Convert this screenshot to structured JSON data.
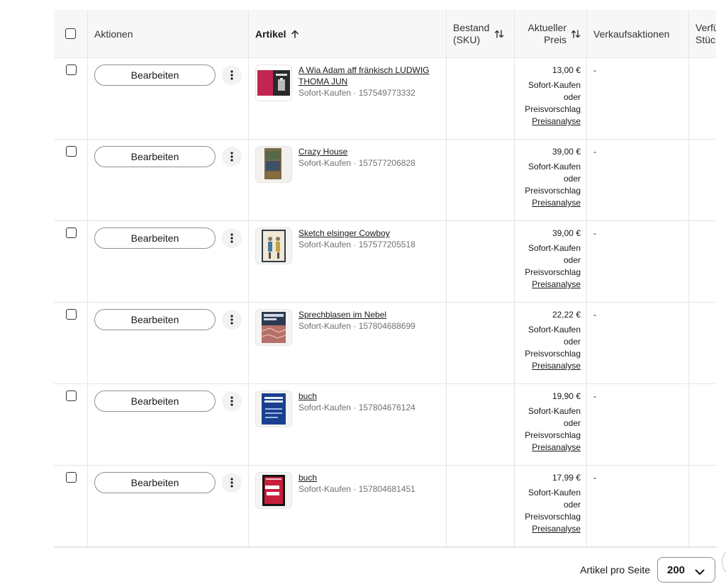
{
  "table": {
    "header": {
      "select_all": "",
      "actions": "Aktionen",
      "item": "Artikel",
      "stock_line1": "Bestand",
      "stock_line2": "(SKU)",
      "price_line1": "Aktueller",
      "price_line2": "Preis",
      "promotions": "Verkaufsaktionen",
      "available_line1": "Verfügbar",
      "available_line2": "Stück"
    },
    "rows": [
      {
        "edit_label": "Bearbeiten",
        "title": "A Wia Adam aff fränkisch LUDWIG THOMA JUN",
        "meta": "Sofort-Kaufen · 157549773332",
        "price": "13,00 €",
        "format": "Sofort-Kaufen oder Preisvorschlag",
        "analysis_link": "Preisanalyse",
        "promo": "-",
        "thumb_icon": "book-cover-red-thumbnail"
      },
      {
        "edit_label": "Bearbeiten",
        "title": "Crazy House",
        "meta": "Sofort-Kaufen · 157577206828",
        "price": "39,00 €",
        "format": "Sofort-Kaufen oder Preisvorschlag",
        "analysis_link": "Preisanalyse",
        "promo": "-",
        "thumb_icon": "painting-thumbnail"
      },
      {
        "edit_label": "Bearbeiten",
        "title": "Sketch elsinger Cowboy",
        "meta": "Sofort-Kaufen · 157577205518",
        "price": "39,00 €",
        "format": "Sofort-Kaufen oder Preisvorschlag",
        "analysis_link": "Preisanalyse",
        "promo": "-",
        "thumb_icon": "sketch-thumbnail"
      },
      {
        "edit_label": "Bearbeiten",
        "title": "Sprechblasen im Nebel",
        "meta": "Sofort-Kaufen · 157804688699",
        "price": "22,22 €",
        "format": "Sofort-Kaufen oder Preisvorschlag",
        "analysis_link": "Preisanalyse",
        "promo": "-",
        "thumb_icon": "book-cover-dark-thumbnail"
      },
      {
        "edit_label": "Bearbeiten",
        "title": "buch",
        "meta": "Sofort-Kaufen · 157804676124",
        "price": "19,90 €",
        "format": "Sofort-Kaufen oder Preisvorschlag",
        "analysis_link": "Preisanalyse",
        "promo": "-",
        "thumb_icon": "book-cover-blue-thumbnail"
      },
      {
        "edit_label": "Bearbeiten",
        "title": "buch",
        "meta": "Sofort-Kaufen · 157804681451",
        "price": "17,99 €",
        "format": "Sofort-Kaufen oder Preisvorschlag",
        "analysis_link": "Preisanalyse",
        "promo": "-",
        "thumb_icon": "book-cover-black-thumbnail"
      }
    ]
  },
  "pagination": {
    "per_page_label": "Artikel pro Seite",
    "per_page_value": "200"
  },
  "colors": {
    "border": "#e5e5e5",
    "header_bg": "#f7f7f7",
    "text": "#191919",
    "muted": "#707070"
  }
}
